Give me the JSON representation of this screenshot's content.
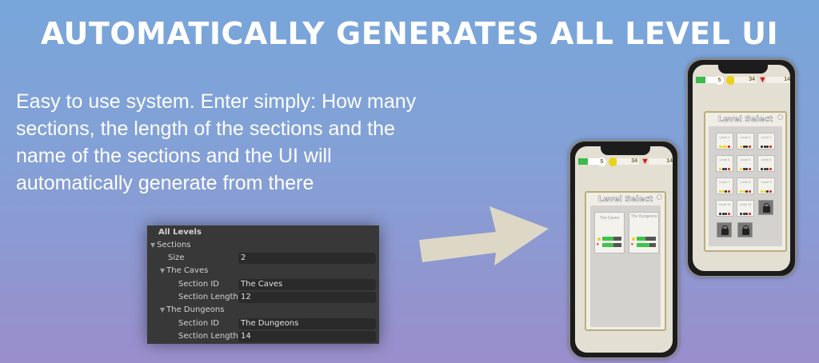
{
  "title": "AUTOMATICALLY GENERATES ALL LEVEL UI",
  "description": "Easy to use system. Enter simply: How many sections, the length of the sections and the name of the sections and the UI will automatically generate from there",
  "inspector": {
    "header": "All Levels",
    "sections_label": "Sections",
    "size_label": "Size",
    "size_value": "2",
    "sections": [
      {
        "name": "The Caves",
        "id_label": "Section ID",
        "id_value": "The Caves",
        "length_label": "Section Length",
        "length_value": "12"
      },
      {
        "name": "The Dungeons",
        "id_label": "Section ID",
        "id_value": "The Dungeons",
        "length_label": "Section Length",
        "length_value": "14"
      }
    ]
  },
  "colors": {
    "accent_green": "#3cc44c",
    "coin": "#e8d21a",
    "gem": "#d81b1b",
    "arrow": "#ddd7c6"
  },
  "phone_hud": {
    "lives": "5",
    "coins": "34",
    "gems": "14"
  },
  "level_select_title": "Level Select",
  "section_cards": [
    {
      "name": "The Caves",
      "coin_progress": 0.6,
      "heart_progress": 0.6
    },
    {
      "name": "The Dungeons",
      "coin_progress": 0.45,
      "heart_progress": 0.65
    }
  ],
  "levels": [
    {
      "label": "Level 1",
      "stars": 3
    },
    {
      "label": "Level 2",
      "stars": 1
    },
    {
      "label": "Level 3",
      "stars": 0
    },
    {
      "label": "Level 4",
      "stars": 1
    },
    {
      "label": "Level 5",
      "stars": 1
    },
    {
      "label": "Level 6",
      "stars": 0
    },
    {
      "label": "Level 7",
      "stars": 2
    },
    {
      "label": "Level 8",
      "stars": 2
    },
    {
      "label": "Level 9",
      "stars": 2
    },
    {
      "label": "Level 10",
      "stars": 0
    },
    {
      "label": "Level 11",
      "stars": 0
    }
  ],
  "locked_levels": 3
}
